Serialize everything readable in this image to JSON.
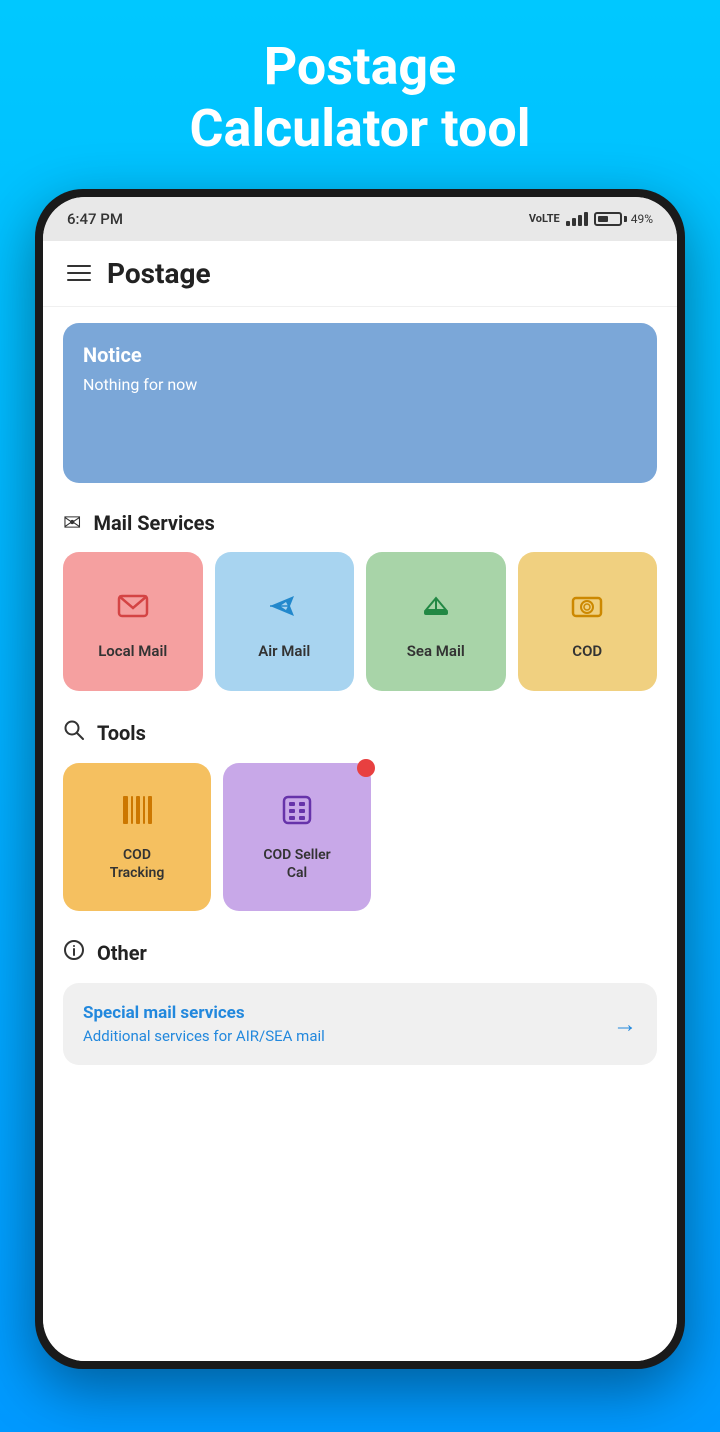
{
  "hero": {
    "title": "Postage\nCalculator tool"
  },
  "statusBar": {
    "time": "6:47 PM",
    "battery": "49%",
    "signal": "4 bars"
  },
  "header": {
    "title": "Postage"
  },
  "notice": {
    "title": "Notice",
    "text": "Nothing for now"
  },
  "mailServices": {
    "sectionTitle": "Mail Services",
    "items": [
      {
        "id": "local-mail",
        "label": "Local Mail",
        "colorClass": "local-mail"
      },
      {
        "id": "air-mail",
        "label": "Air Mail",
        "colorClass": "air-mail"
      },
      {
        "id": "sea-mail",
        "label": "Sea Mail",
        "colorClass": "sea-mail"
      },
      {
        "id": "cod",
        "label": "COD",
        "colorClass": "cod"
      }
    ]
  },
  "tools": {
    "sectionTitle": "Tools",
    "items": [
      {
        "id": "cod-tracking",
        "label": "COD\nTracking",
        "colorClass": "cod-tracking",
        "hasNotification": false
      },
      {
        "id": "cod-seller-cal",
        "label": "COD Seller\nCal",
        "colorClass": "cod-seller",
        "hasNotification": true
      }
    ]
  },
  "other": {
    "sectionTitle": "Other",
    "card": {
      "title": "Special mail services",
      "subtitle": "Additional services for AIR/SEA mail"
    }
  }
}
